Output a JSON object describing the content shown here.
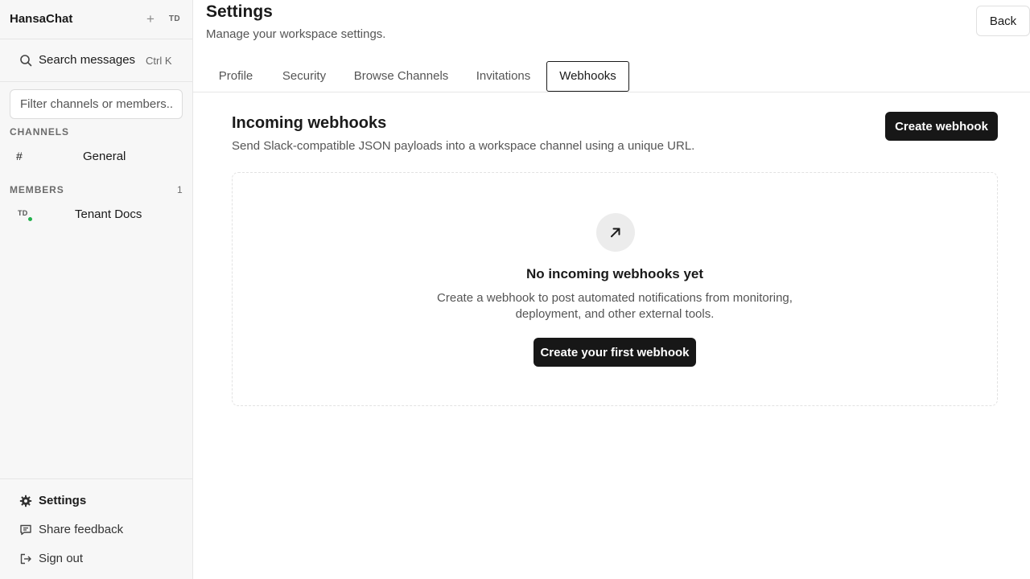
{
  "workspace": {
    "name": "HansaChat",
    "add_icon": "plus-icon",
    "avatar_initials": "TD"
  },
  "search": {
    "label": "Search messages",
    "shortcut": "Ctrl K",
    "icon": "search-icon"
  },
  "filter": {
    "placeholder": "Filter channels or members..."
  },
  "channels": {
    "label": "CHANNELS",
    "items": [
      {
        "prefix": "#",
        "name": "General"
      }
    ]
  },
  "members": {
    "label": "MEMBERS",
    "count": "1",
    "items": [
      {
        "initials": "TD",
        "name": "Tenant Docs",
        "status": "online",
        "status_color": "#22b14c"
      }
    ]
  },
  "sidebar_bottom": {
    "items": [
      {
        "label": "Settings",
        "icon": "gear-icon",
        "active": true
      },
      {
        "label": "Share feedback",
        "icon": "message-icon"
      },
      {
        "label": "Sign out",
        "icon": "sign-out-icon"
      }
    ]
  },
  "page": {
    "title": "Settings",
    "subtitle": "Manage your workspace settings.",
    "back_label": "Back"
  },
  "tabs": [
    {
      "label": "Profile"
    },
    {
      "label": "Security"
    },
    {
      "label": "Browse Channels"
    },
    {
      "label": "Invitations"
    },
    {
      "label": "Webhooks",
      "active": true
    }
  ],
  "webhooks": {
    "title": "Incoming webhooks",
    "description": "Send Slack-compatible JSON payloads into a workspace channel using a unique URL.",
    "create_label": "Create webhook",
    "empty": {
      "icon": "arrow-up-right-icon",
      "title": "No incoming webhooks yet",
      "description_line1": "Create a webhook to post automated notifications from monitoring,",
      "description_line2": "deployment, and other external tools.",
      "button_label": "Create your first webhook"
    }
  },
  "colors": {
    "primary_button": "#171717",
    "online_status": "#22b14c",
    "sidebar_bg": "#f7f7f7"
  }
}
